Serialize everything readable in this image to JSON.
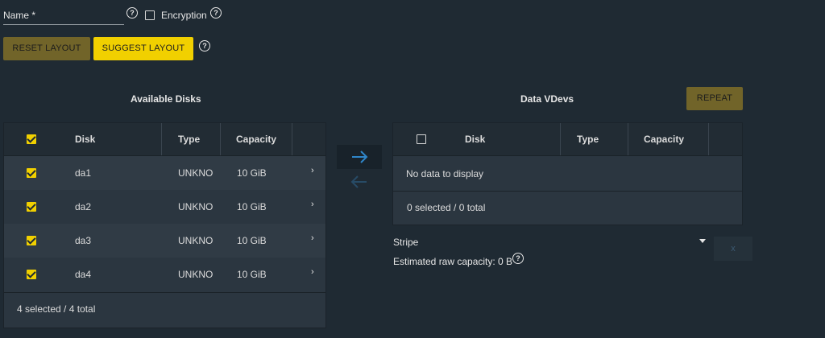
{
  "form": {
    "name_label": "Name *",
    "name_value": "",
    "encryption_label": "Encryption",
    "help_glyph": "?"
  },
  "buttons": {
    "reset_layout": "RESET LAYOUT",
    "suggest_layout": "SUGGEST LAYOUT",
    "repeat": "REPEAT",
    "remove": "x"
  },
  "available_disks": {
    "title": "Available Disks",
    "columns": [
      "Disk",
      "Type",
      "Capacity"
    ],
    "rows": [
      {
        "disk": "da1",
        "type": "UNKNO",
        "capacity": "10 GiB",
        "checked": true
      },
      {
        "disk": "da2",
        "type": "UNKNO",
        "capacity": "10 GiB",
        "checked": true
      },
      {
        "disk": "da3",
        "type": "UNKNO",
        "capacity": "10 GiB",
        "checked": true
      },
      {
        "disk": "da4",
        "type": "UNKNO",
        "capacity": "10 GiB",
        "checked": true
      }
    ],
    "footer": "4 selected / 4 total"
  },
  "data_vdevs": {
    "title": "Data VDevs",
    "columns": [
      "Disk",
      "Type",
      "Capacity"
    ],
    "empty_message": "No data to display",
    "footer": "0 selected / 0 total",
    "type_select": "Stripe",
    "estimated_capacity": "Estimated raw capacity: 0 B"
  },
  "icons": {
    "help": "help-circle-icon",
    "move_right": "arrow-right-icon",
    "move_left": "arrow-left-icon",
    "row_expand": "chevron-right-icon",
    "dropdown": "caret-down-icon"
  },
  "colors": {
    "background": "#1f2a33",
    "accent": "#f1d000",
    "accent_muted": "#716429",
    "arrow_active": "#2f86c9",
    "arrow_inactive": "#274b66"
  }
}
